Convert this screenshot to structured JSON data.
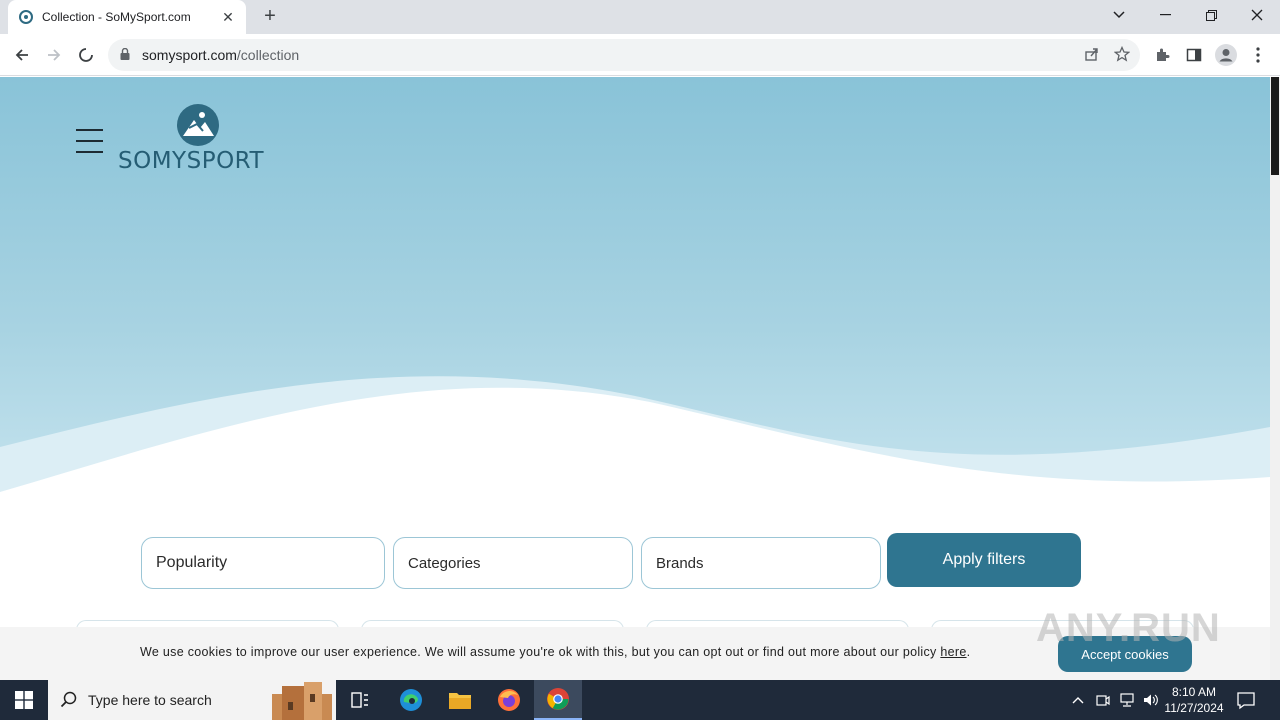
{
  "browser": {
    "tab_title": "Collection - SoMySport.com",
    "tab_close": "✕",
    "new_tab": "+",
    "url_host": "somysport.com",
    "url_path": "/collection",
    "window_controls": [
      "minimize",
      "restore",
      "close"
    ]
  },
  "site": {
    "logo_text": "SOMYSPORT",
    "menu_icon": "hamburger-menu-icon"
  },
  "filters": {
    "sort_label": "Popularity",
    "categories_label": "Categories",
    "brands_label": "Brands",
    "apply_label": "Apply filters"
  },
  "cookie": {
    "message": "We use cookies to improve our user experience. We will assume you're ok with this, but you can opt out or find out more about our policy ",
    "link": "here",
    "suffix": ".",
    "accept_label": "Accept cookies"
  },
  "watermark": "ANY.RUN",
  "taskbar": {
    "search_placeholder": "Type here to search",
    "time": "8:10 AM",
    "date": "11/27/2024"
  },
  "colors": {
    "accent": "#2f7590",
    "hero_top": "#89c3d8",
    "logo": "#255d74"
  }
}
